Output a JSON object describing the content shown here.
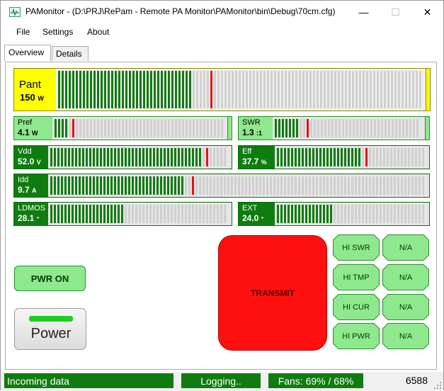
{
  "window": {
    "title": "PAMonitor -  (D:\\PRJ\\RePam - Remote PA Monitor\\PAMonitor\\bin\\Debug\\70cm.cfg)",
    "minimize_glyph": "—",
    "maximize_glyph": "☐",
    "close_glyph": "✕"
  },
  "menu": {
    "items": [
      "File",
      "Settings",
      "About"
    ]
  },
  "tabs": [
    "Overview",
    "Details"
  ],
  "meters": {
    "pant": {
      "name": "Pant",
      "value": "150",
      "unit": "W",
      "level": 0.37,
      "peak": 0.42
    },
    "pref": {
      "name": "Pref",
      "value": "4.1",
      "unit": "W",
      "level": 0.09,
      "peak": 0.11
    },
    "swr": {
      "name": "SWR",
      "value": "1.3",
      "unit": ":1",
      "level": 0.18,
      "peak": 0.22
    },
    "vdd": {
      "name": "Vdd",
      "value": "52.0",
      "unit": "V",
      "level": 0.86,
      "peak": 0.88
    },
    "eff": {
      "name": "Eff",
      "value": "37.7",
      "unit": "%",
      "level": 0.56,
      "peak": 0.59
    },
    "idd": {
      "name": "Idd",
      "value": "9.7",
      "unit": "A",
      "level": 0.36,
      "peak": 0.38
    },
    "ldmos": {
      "name": "LDMOS",
      "value": "28.1",
      "unit": "°",
      "level": 0.42,
      "peak": 0.0
    },
    "ext": {
      "name": "EXT",
      "value": "24.0",
      "unit": "°",
      "level": 0.38,
      "peak": 0.0
    }
  },
  "buttons": {
    "pwr_on": "PWR ON",
    "power": "Power",
    "transmit": "TRANSMIT"
  },
  "alarms": [
    [
      "HI SWR",
      "N/A"
    ],
    [
      "HI TMP",
      "N/A"
    ],
    [
      "HI CUR",
      "N/A"
    ],
    [
      "HI PWR",
      "N/A"
    ]
  ],
  "status": {
    "incoming": "Incoming data",
    "logging": "Logging..",
    "fans": "Fans: 69% / 68%",
    "count": "6588"
  },
  "colors": {
    "bar_on": "#0f7c0f",
    "bar_off": "#d0d0d0",
    "peak": "#e81010",
    "status_green": "#0f7c0f",
    "button_green": "#8ee88e",
    "transmit_red": "#ff1010"
  }
}
